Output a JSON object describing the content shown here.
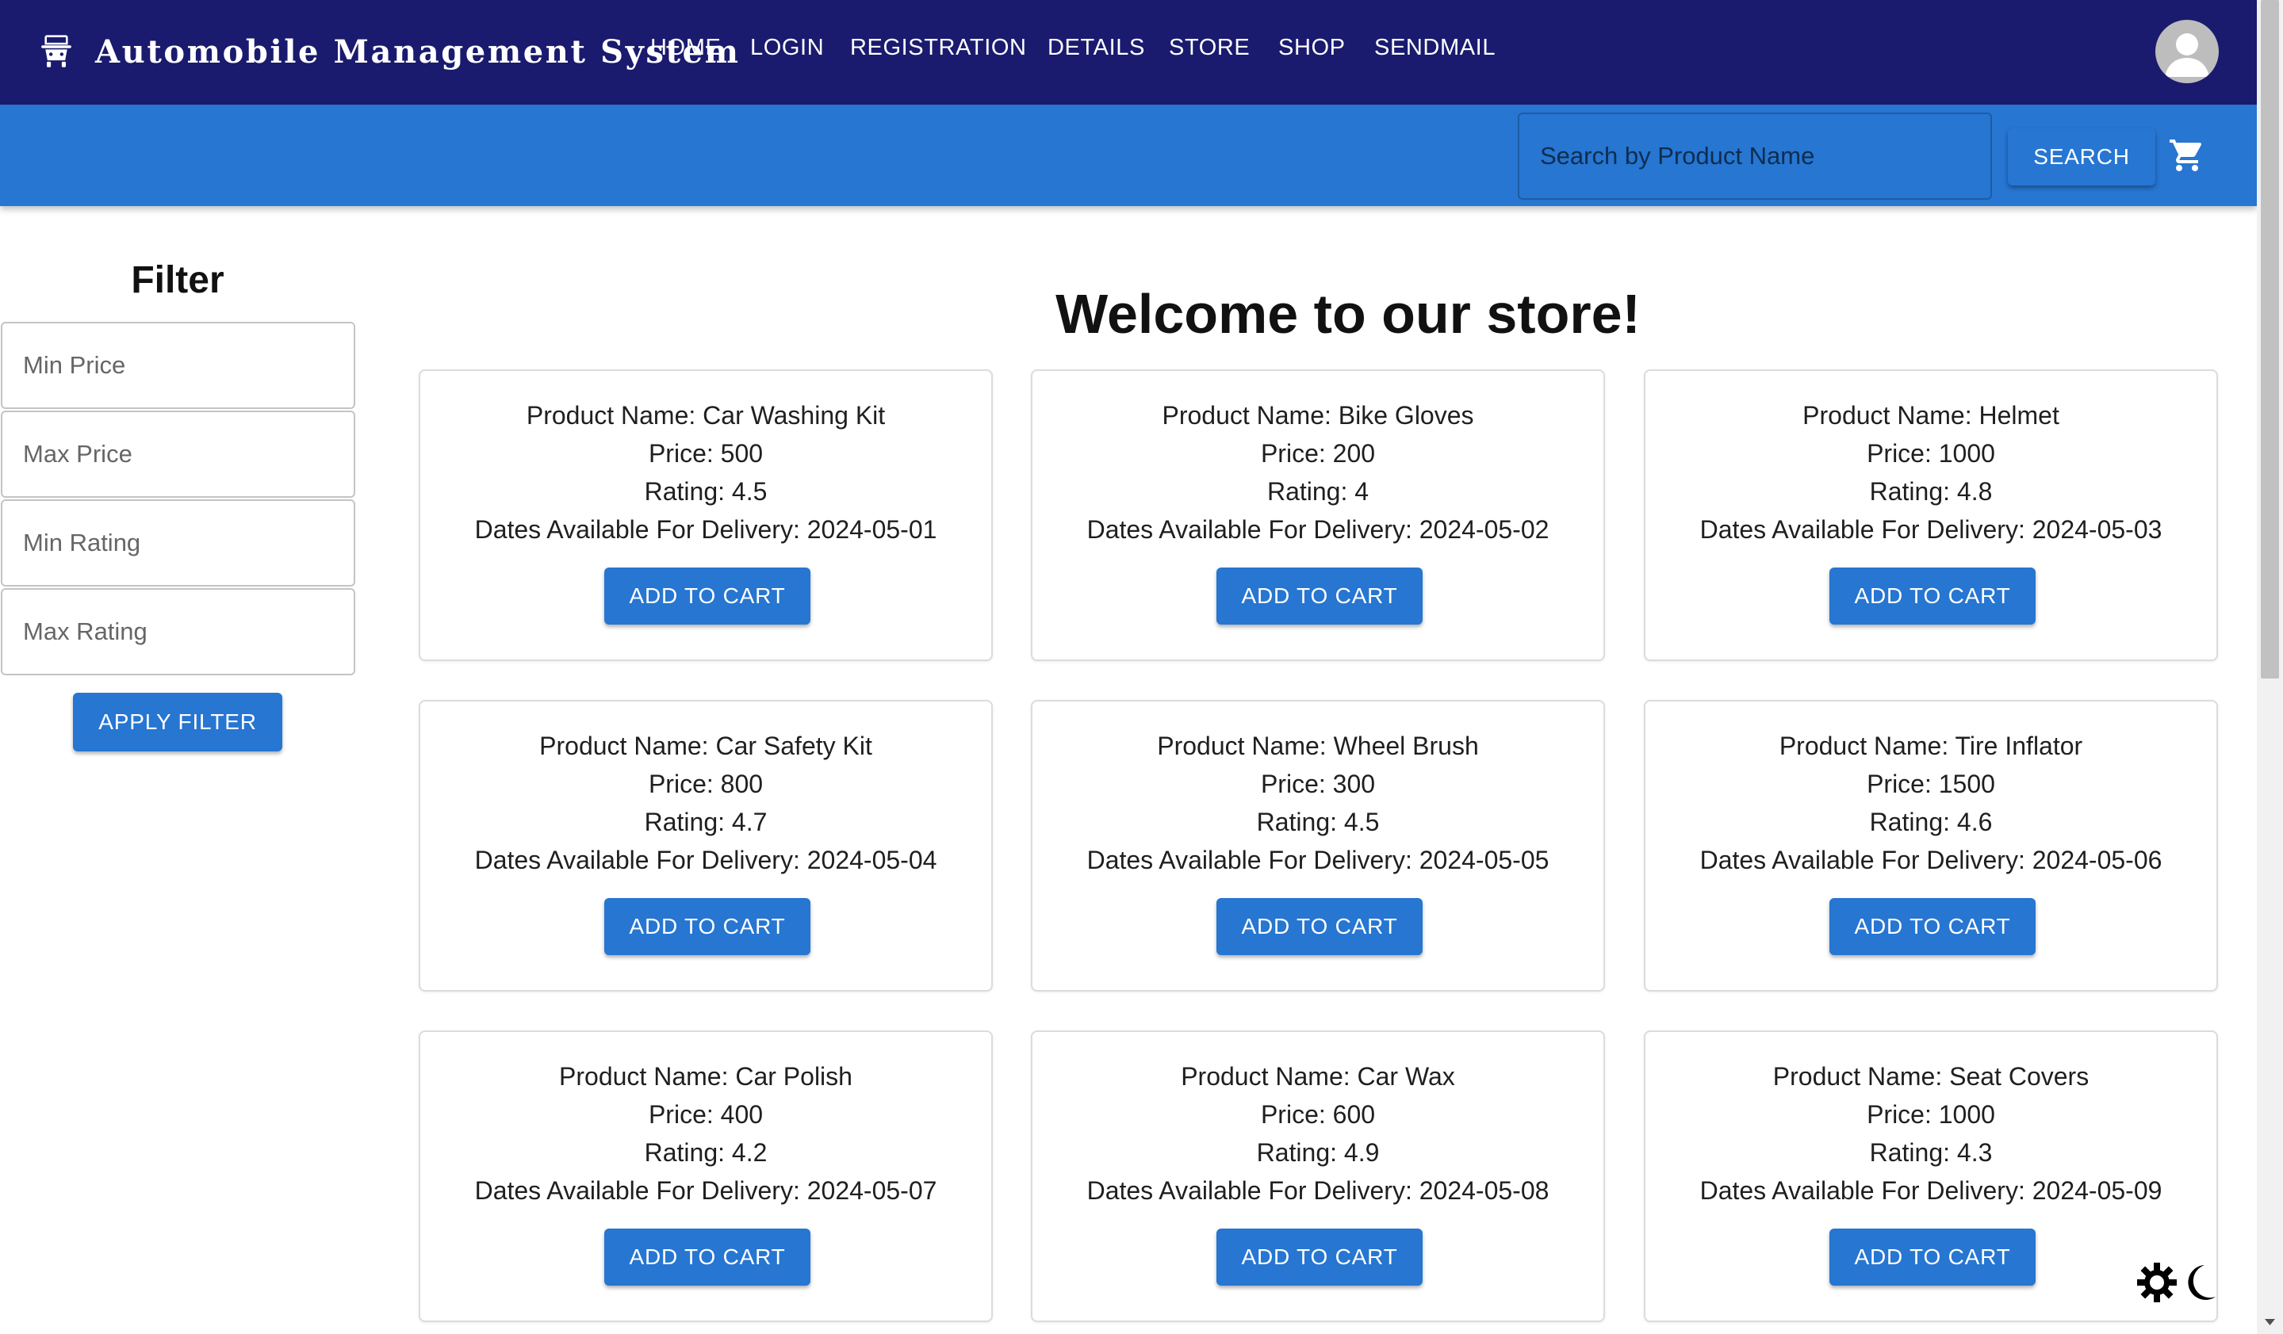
{
  "header": {
    "title": "Automobile Management System",
    "brand_icon": "car-seat-icon",
    "nav": [
      {
        "label": "HOME"
      },
      {
        "label": "LOGIN"
      },
      {
        "label": "REGISTRATION"
      },
      {
        "label": "DETAILS"
      },
      {
        "label": "STORE"
      },
      {
        "label": "SHOP"
      },
      {
        "label": "SENDMAIL"
      }
    ],
    "avatar_icon": "user-avatar-icon"
  },
  "search": {
    "placeholder": "Search by Product Name",
    "button_label": "SEARCH",
    "cart_icon": "shopping-cart-icon"
  },
  "filter": {
    "title": "Filter",
    "fields": [
      {
        "placeholder": "Min Price"
      },
      {
        "placeholder": "Max Price"
      },
      {
        "placeholder": "Min Rating"
      },
      {
        "placeholder": "Max Rating"
      }
    ],
    "apply_label": "APPLY FILTER"
  },
  "store": {
    "title": "Welcome to our store!",
    "add_to_cart_label": "ADD TO CART",
    "products": [
      {
        "name": "Product Name: Car Washing Kit",
        "price": "Price: 500",
        "rating": "Rating: 4.5",
        "delivery": "Dates Available For Delivery: 2024-05-01"
      },
      {
        "name": "Product Name: Bike Gloves",
        "price": "Price: 200",
        "rating": "Rating: 4",
        "delivery": "Dates Available For Delivery: 2024-05-02"
      },
      {
        "name": "Product Name: Helmet",
        "price": "Price: 1000",
        "rating": "Rating: 4.8",
        "delivery": "Dates Available For Delivery: 2024-05-03"
      },
      {
        "name": "Product Name: Car Safety Kit",
        "price": "Price: 800",
        "rating": "Rating: 4.7",
        "delivery": "Dates Available For Delivery: 2024-05-04"
      },
      {
        "name": "Product Name: Wheel Brush",
        "price": "Price: 300",
        "rating": "Rating: 4.5",
        "delivery": "Dates Available For Delivery: 2024-05-05"
      },
      {
        "name": "Product Name: Tire Inflator",
        "price": "Price: 1500",
        "rating": "Rating: 4.6",
        "delivery": "Dates Available For Delivery: 2024-05-06"
      },
      {
        "name": "Product Name: Car Polish",
        "price": "Price: 400",
        "rating": "Rating: 4.2",
        "delivery": "Dates Available For Delivery: 2024-05-07"
      },
      {
        "name": "Product Name: Car Wax",
        "price": "Price: 600",
        "rating": "Rating: 4.9",
        "delivery": "Dates Available For Delivery: 2024-05-08"
      },
      {
        "name": "Product Name: Seat Covers",
        "price": "Price: 1000",
        "rating": "Rating: 4.3",
        "delivery": "Dates Available For Delivery: 2024-05-09"
      }
    ]
  },
  "theme_toggle": {
    "icons": [
      "sun-icon",
      "moon-icon"
    ]
  },
  "colors": {
    "navbar": "#1a1b6e",
    "primary": "#2676d2",
    "text": "#1f1f1f"
  }
}
